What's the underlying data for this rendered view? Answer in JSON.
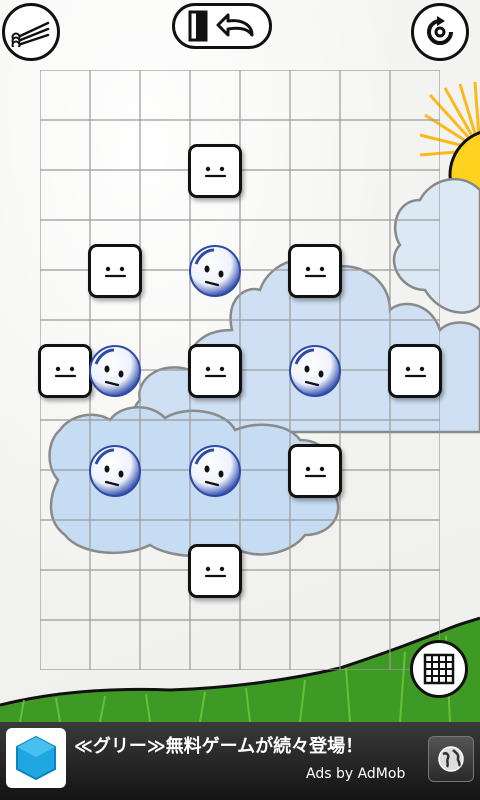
{
  "game": {
    "grid": {
      "columns": 8,
      "rows": 12
    },
    "blocks": [
      {
        "col": 3,
        "row": 1
      },
      {
        "col": 1,
        "row": 3
      },
      {
        "col": 5,
        "row": 3
      },
      {
        "col": 0,
        "row": 5
      },
      {
        "col": 3,
        "row": 5
      },
      {
        "col": 7,
        "row": 5
      },
      {
        "col": 5,
        "row": 7
      },
      {
        "col": 3,
        "row": 9
      }
    ],
    "balls": [
      {
        "col": 3,
        "row": 3
      },
      {
        "col": 1,
        "row": 5
      },
      {
        "col": 5,
        "row": 5
      },
      {
        "col": 1,
        "row": 7
      },
      {
        "col": 3,
        "row": 7
      }
    ]
  },
  "toolbar": {
    "menu_icon": "matches-menu-icon",
    "undo_icon": "door-undo-icon",
    "restart_icon": "restart-icon",
    "grid_toggle_icon": "grid-icon"
  },
  "ad": {
    "text": "≪グリー≫無料ゲームが続々登場！",
    "credit": "Ads by AdMob",
    "logo_color": "#1ea7e1"
  },
  "colors": {
    "sky_cloud": "#cfe0f4",
    "sun": "#ffd21f",
    "grass": "#3f9a25"
  }
}
